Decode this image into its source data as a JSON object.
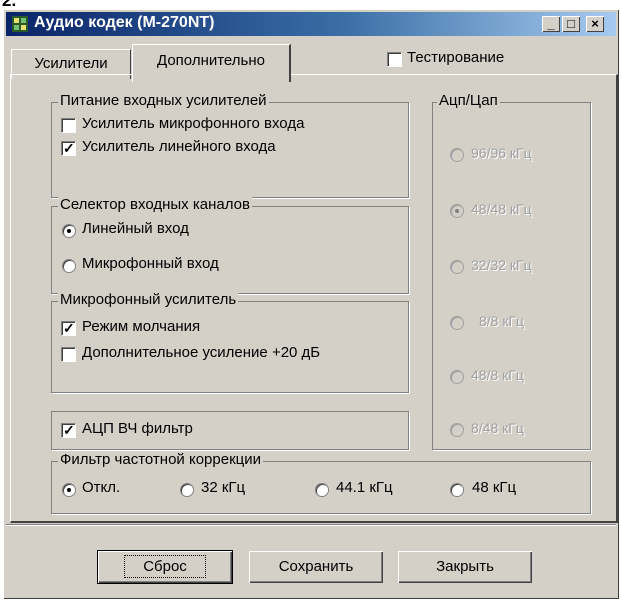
{
  "window": {
    "title": "Аудио кодек (М-270NT)",
    "top_glyph": "2."
  },
  "titlebar": {
    "min_glyph": "_",
    "max_glyph": "□",
    "close_glyph": "×"
  },
  "tabs": [
    {
      "label": "Усилители",
      "active": false
    },
    {
      "label": "Дополнительно",
      "active": true
    }
  ],
  "testing": {
    "label": "Тестирование",
    "checked": false
  },
  "input_amp_power": {
    "title": "Питание входных усилителей",
    "items": [
      {
        "label": "Усилитель микрофонного входа",
        "checked": false
      },
      {
        "label": "Усилитель линейного входа",
        "checked": true
      }
    ]
  },
  "input_selector": {
    "title": "Селектор входных каналов",
    "items": [
      {
        "label": "Линейный вход",
        "selected": true
      },
      {
        "label": "Микрофонный вход",
        "selected": false
      }
    ]
  },
  "mic_amp": {
    "title": "Микрофонный усилитель",
    "items": [
      {
        "label": "Режим молчания",
        "checked": true
      },
      {
        "label": "Дополнительное усиление +20 дБ",
        "checked": false
      }
    ]
  },
  "adc_hf": {
    "label": "АЦП ВЧ фильтр",
    "checked": true
  },
  "adc_dac": {
    "title": "Ацп/Цап",
    "options": [
      {
        "label": "96/96 кГц",
        "selected": false
      },
      {
        "label": "48/48 кГц",
        "selected": true
      },
      {
        "label": "32/32 кГц",
        "selected": false
      },
      {
        "label": "8/8 кГц",
        "selected": false
      },
      {
        "label": "48/8 кГц",
        "selected": false
      },
      {
        "label": "8/48 кГц",
        "selected": false
      }
    ]
  },
  "eq_filter": {
    "title": "Фильтр частотной коррекции",
    "options": [
      {
        "label": "Откл.",
        "selected": true
      },
      {
        "label": "32 кГц",
        "selected": false
      },
      {
        "label": "44.1 кГц",
        "selected": false
      },
      {
        "label": "48 кГц",
        "selected": false
      }
    ]
  },
  "buttons": {
    "reset": "Сброс",
    "save": "Сохранить",
    "close": "Закрыть"
  },
  "colors": {
    "face": "#d4d0c8",
    "title_start": "#0a246a",
    "title_end": "#a6caf0",
    "disabled_text": "#a0a0a0"
  }
}
